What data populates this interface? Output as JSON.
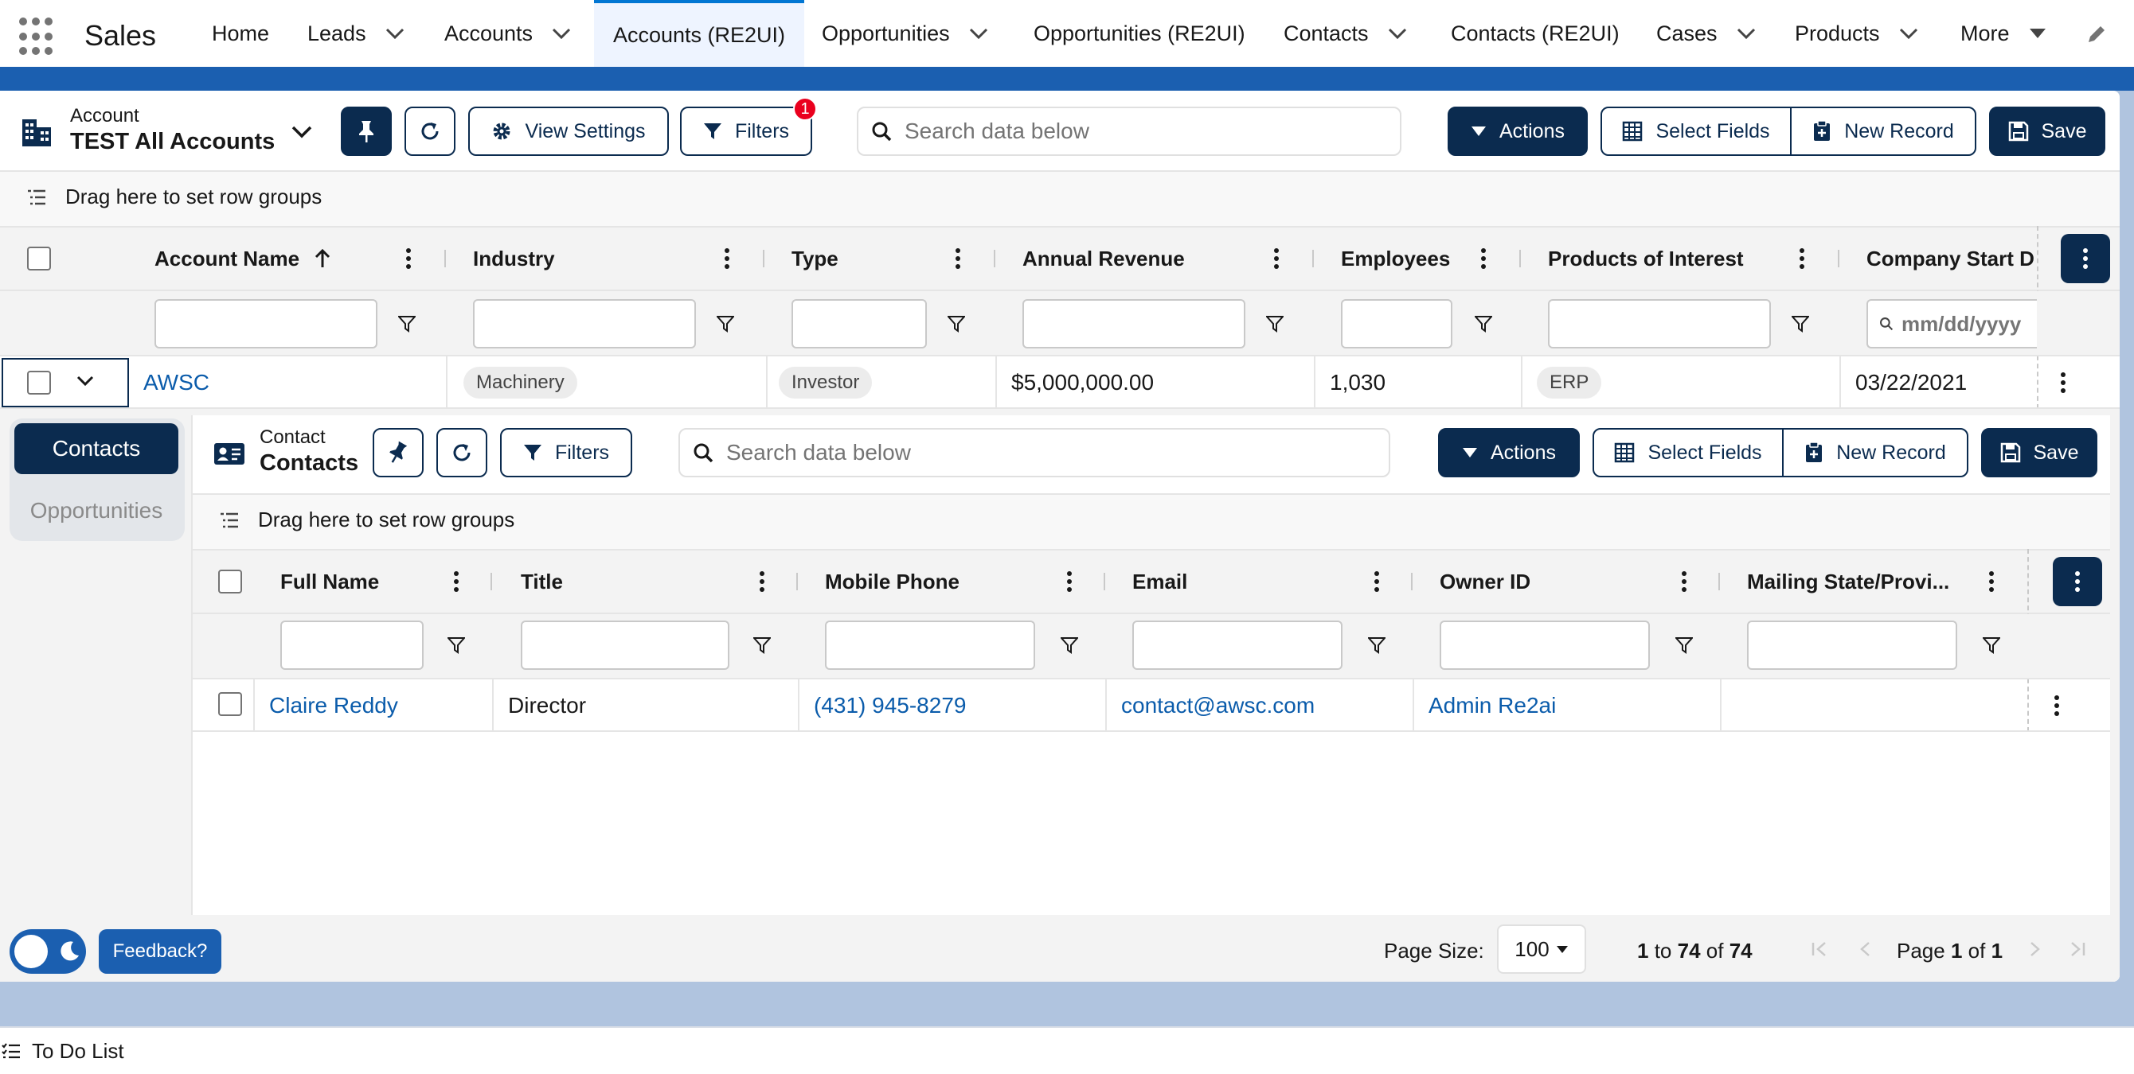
{
  "app": {
    "name": "Sales"
  },
  "nav": [
    {
      "label": "Home",
      "dropdown": false,
      "active": false
    },
    {
      "label": "Leads",
      "dropdown": true,
      "active": false
    },
    {
      "label": "Accounts",
      "dropdown": true,
      "active": false
    },
    {
      "label": "Accounts (RE2UI)",
      "dropdown": false,
      "active": true
    },
    {
      "label": "Opportunities",
      "dropdown": true,
      "active": false
    },
    {
      "label": "Opportunities (RE2UI)",
      "dropdown": false,
      "active": false
    },
    {
      "label": "Contacts",
      "dropdown": true,
      "active": false
    },
    {
      "label": "Contacts (RE2UI)",
      "dropdown": false,
      "active": false
    },
    {
      "label": "Cases",
      "dropdown": true,
      "active": false
    },
    {
      "label": "Products",
      "dropdown": true,
      "active": false
    },
    {
      "label": "More",
      "dropdown": true,
      "active": false
    }
  ],
  "main": {
    "object_label": "Account",
    "list_name": "TEST All Accounts",
    "view_settings_label": "View Settings",
    "filters_label": "Filters",
    "filters_count": "1",
    "search_placeholder": "Search data below",
    "actions_label": "Actions",
    "select_fields_label": "Select Fields",
    "new_record_label": "New Record",
    "save_label": "Save",
    "row_groups_label": "Drag here to set row groups",
    "columns": [
      "Account Name",
      "Industry",
      "Type",
      "Annual Revenue",
      "Employees",
      "Products of Interest",
      "Company Start D"
    ],
    "date_filter_placeholder": "mm/dd/yyyy",
    "row": {
      "account_name": "AWSC",
      "industry": "Machinery",
      "type": "Investor",
      "annual_revenue": "$5,000,000.00",
      "employees": "1,030",
      "products": "ERP",
      "start_date": "03/22/2021"
    }
  },
  "sub": {
    "tabs": [
      "Contacts",
      "Opportunities"
    ],
    "object_label": "Contact",
    "list_name": "Contacts",
    "filters_label": "Filters",
    "search_placeholder": "Search data below",
    "actions_label": "Actions",
    "select_fields_label": "Select Fields",
    "new_record_label": "New Record",
    "save_label": "Save",
    "row_groups_label": "Drag here to set row groups",
    "columns": [
      "Full Name",
      "Title",
      "Mobile Phone",
      "Email",
      "Owner ID",
      "Mailing State/Provi..."
    ],
    "row": {
      "full_name": "Claire Reddy",
      "title": "Director",
      "mobile": "(431) 945-8279",
      "email": "contact@awsc.com",
      "owner": "Admin Re2ai",
      "state": ""
    }
  },
  "footer": {
    "feedback_label": "Feedback?",
    "page_size_label": "Page Size:",
    "page_size_value": "100",
    "range_from": "1",
    "range_to": "74",
    "range_total": "74",
    "to_word": "to",
    "of_word": "of",
    "page_word": "Page",
    "page_current": "1",
    "page_total": "1"
  },
  "todo_label": "To Do List",
  "colors": {
    "brand_dark": "#0b2b4f",
    "link": "#0b5cab",
    "badge": "#ea001e",
    "band": "#1b5fb0"
  }
}
